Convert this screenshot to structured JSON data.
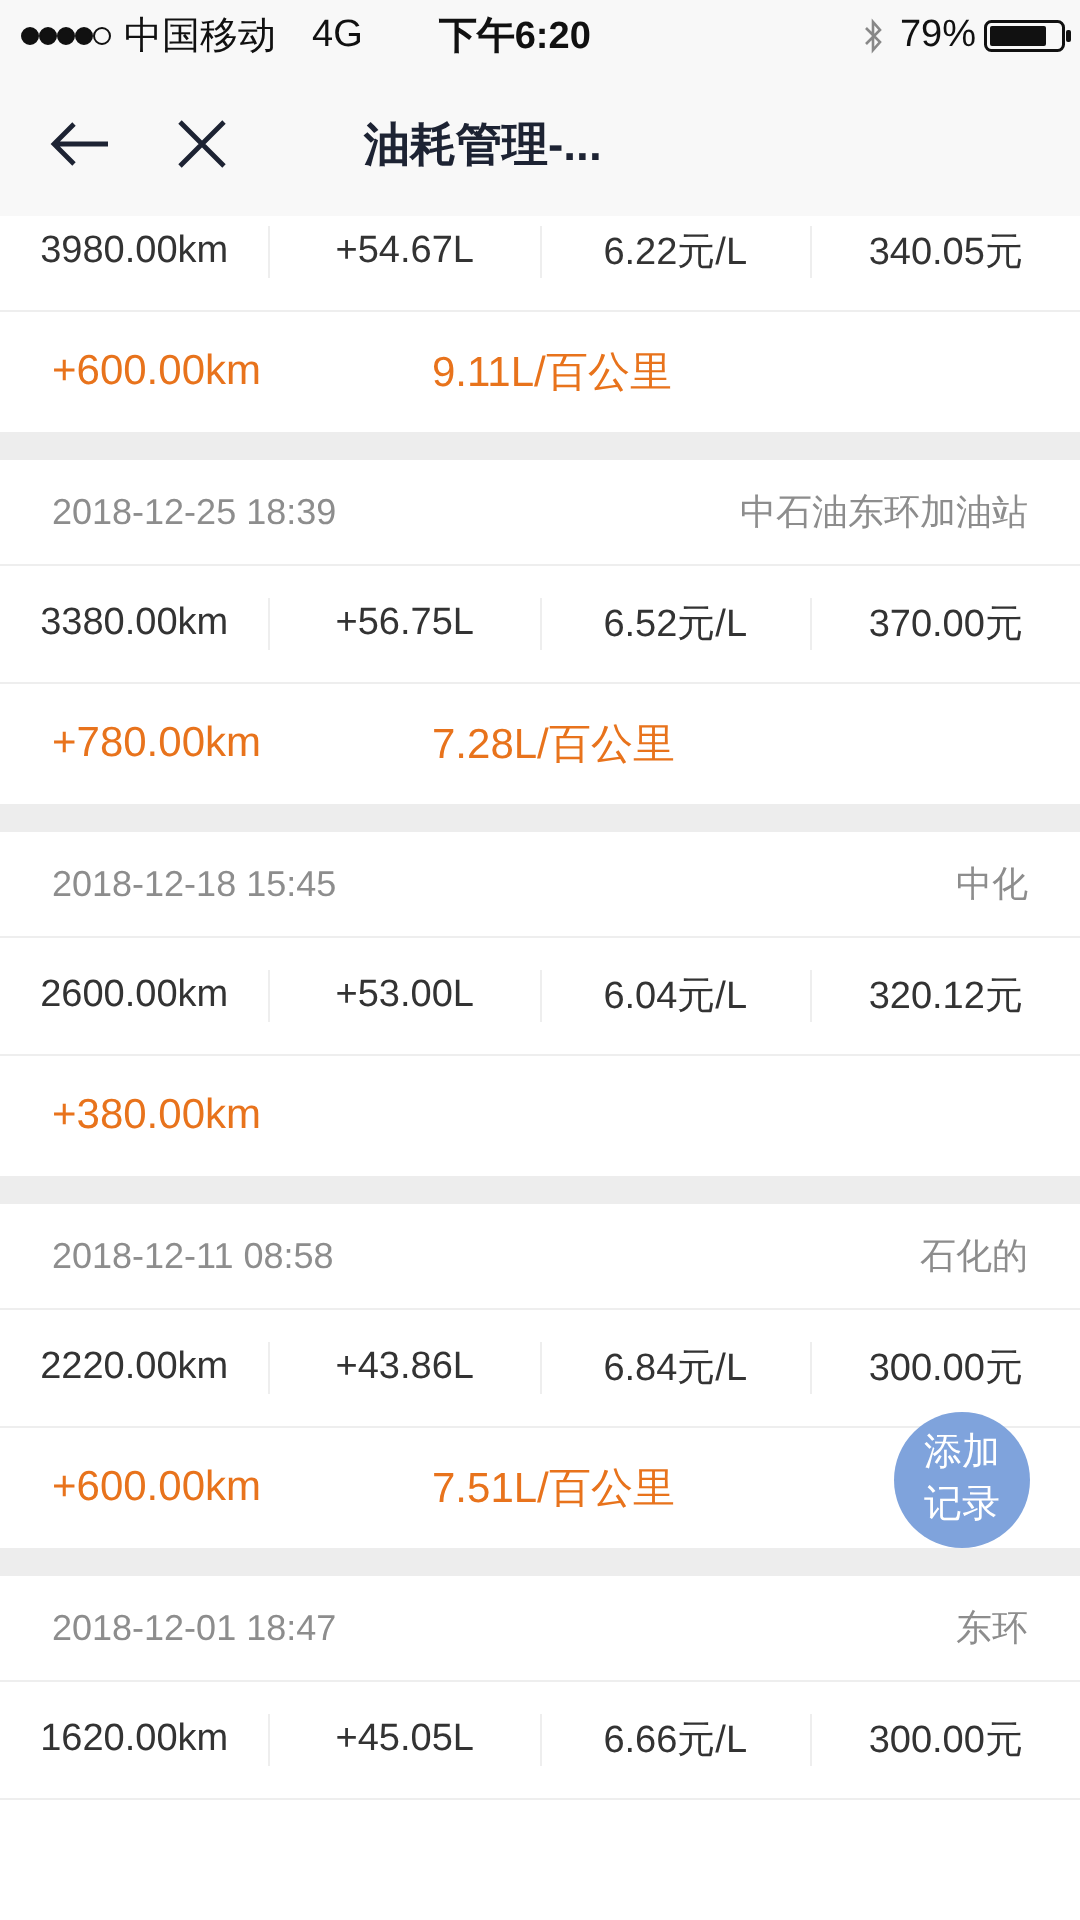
{
  "status_bar": {
    "carrier": "中国移动",
    "network": "4G",
    "time": "下午6:20",
    "battery": "79%"
  },
  "nav": {
    "title": "油耗管理-..."
  },
  "records": [
    {
      "odometer": "3980.00km",
      "fuel": "+54.67L",
      "price": "6.22元/L",
      "cost": "340.05元",
      "distance": "+600.00km",
      "consumption": "9.11L/百公里"
    },
    {
      "date": "2018-12-25 18:39",
      "station": "中石油东环加油站",
      "odometer": "3380.00km",
      "fuel": "+56.75L",
      "price": "6.52元/L",
      "cost": "370.00元",
      "distance": "+780.00km",
      "consumption": "7.28L/百公里"
    },
    {
      "date": "2018-12-18 15:45",
      "station": "中化",
      "odometer": "2600.00km",
      "fuel": "+53.00L",
      "price": "6.04元/L",
      "cost": "320.12元",
      "distance": "+380.00km"
    },
    {
      "date": "2018-12-11 08:58",
      "station": "石化的",
      "odometer": "2220.00km",
      "fuel": "+43.86L",
      "price": "6.84元/L",
      "cost": "300.00元",
      "distance": "+600.00km",
      "consumption": "7.51L/百公里"
    },
    {
      "date": "2018-12-01 18:47",
      "station": "东环",
      "odometer": "1620.00km",
      "fuel": "+45.05L",
      "price": "6.66元/L",
      "cost": "300.00元"
    }
  ],
  "add_button": {
    "label": "添加记录"
  }
}
